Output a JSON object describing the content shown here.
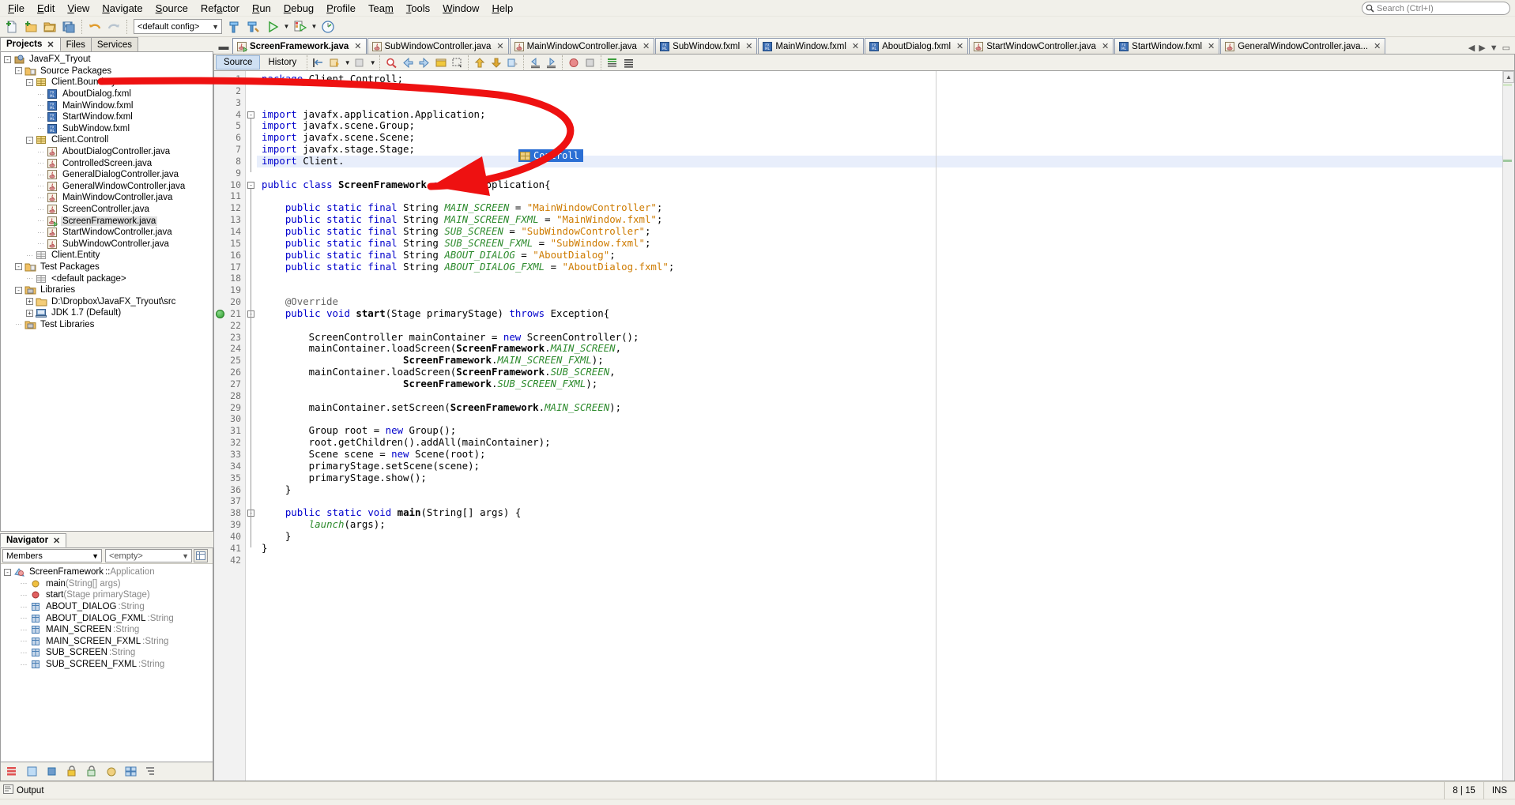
{
  "window": {
    "title": "NetBeans IDE"
  },
  "menubar": {
    "items": [
      {
        "label": "File",
        "mnemonic": "F"
      },
      {
        "label": "Edit",
        "mnemonic": "E"
      },
      {
        "label": "View",
        "mnemonic": "V"
      },
      {
        "label": "Navigate",
        "mnemonic": "N"
      },
      {
        "label": "Source",
        "mnemonic": "S"
      },
      {
        "label": "Refactor",
        "mnemonic": "a"
      },
      {
        "label": "Run",
        "mnemonic": "R"
      },
      {
        "label": "Debug",
        "mnemonic": "D"
      },
      {
        "label": "Profile",
        "mnemonic": "P"
      },
      {
        "label": "Team",
        "mnemonic": "m"
      },
      {
        "label": "Tools",
        "mnemonic": "T"
      },
      {
        "label": "Window",
        "mnemonic": "W"
      },
      {
        "label": "Help",
        "mnemonic": "H"
      }
    ],
    "search_placeholder": "Search (Ctrl+I)"
  },
  "toolbar": {
    "config_value": "<default config>",
    "buttons": [
      {
        "name": "new-file-button",
        "title": "New File"
      },
      {
        "name": "new-project-button",
        "title": "New Project"
      },
      {
        "name": "open-project-button",
        "title": "Open Project"
      },
      {
        "name": "save-all-button",
        "title": "Save All"
      },
      {
        "name": "undo-button",
        "title": "Undo"
      },
      {
        "name": "redo-button",
        "title": "Redo"
      },
      {
        "name": "build-project-button",
        "title": "Build Project"
      },
      {
        "name": "clean-build-button",
        "title": "Clean and Build Project"
      },
      {
        "name": "run-project-button",
        "title": "Run Project"
      },
      {
        "name": "debug-project-button",
        "title": "Debug Project"
      },
      {
        "name": "profile-project-button",
        "title": "Profile Project"
      }
    ]
  },
  "left_panel": {
    "tabs": [
      {
        "label": "Projects",
        "active": true,
        "closable": true
      },
      {
        "label": "Files",
        "active": false,
        "closable": false
      },
      {
        "label": "Services",
        "active": false,
        "closable": false
      }
    ],
    "tree": [
      {
        "label": "JavaFX_Tryout",
        "indent": 0,
        "icon": "project-icon",
        "expander": "-"
      },
      {
        "label": "Source Packages",
        "indent": 1,
        "icon": "source-packages-icon",
        "expander": "-"
      },
      {
        "label": "Client.Boundary",
        "indent": 2,
        "icon": "package-icon",
        "expander": "-"
      },
      {
        "label": "AboutDialog.fxml",
        "indent": 3,
        "icon": "fxml-icon",
        "expander": ""
      },
      {
        "label": "MainWindow.fxml",
        "indent": 3,
        "icon": "fxml-icon",
        "expander": ""
      },
      {
        "label": "StartWindow.fxml",
        "indent": 3,
        "icon": "fxml-icon",
        "expander": ""
      },
      {
        "label": "SubWindow.fxml",
        "indent": 3,
        "icon": "fxml-icon",
        "expander": ""
      },
      {
        "label": "Client.Controll",
        "indent": 2,
        "icon": "package-icon",
        "expander": "-"
      },
      {
        "label": "AboutDialogController.java",
        "indent": 3,
        "icon": "java-icon",
        "expander": ""
      },
      {
        "label": "ControlledScreen.java",
        "indent": 3,
        "icon": "java-icon",
        "expander": ""
      },
      {
        "label": "GeneralDialogController.java",
        "indent": 3,
        "icon": "java-icon",
        "expander": ""
      },
      {
        "label": "GeneralWindowController.java",
        "indent": 3,
        "icon": "java-icon",
        "expander": ""
      },
      {
        "label": "MainWindowController.java",
        "indent": 3,
        "icon": "java-icon",
        "expander": ""
      },
      {
        "label": "ScreenController.java",
        "indent": 3,
        "icon": "java-icon",
        "expander": ""
      },
      {
        "label": "ScreenFramework.java",
        "indent": 3,
        "icon": "java-main-icon",
        "expander": "",
        "selected": true
      },
      {
        "label": "StartWindowController.java",
        "indent": 3,
        "icon": "java-icon",
        "expander": ""
      },
      {
        "label": "SubWindowController.java",
        "indent": 3,
        "icon": "java-icon",
        "expander": ""
      },
      {
        "label": "Client.Entity",
        "indent": 2,
        "icon": "package-empty-icon",
        "expander": ""
      },
      {
        "label": "Test Packages",
        "indent": 1,
        "icon": "test-packages-icon",
        "expander": "-"
      },
      {
        "label": "<default package>",
        "indent": 2,
        "icon": "package-empty-icon",
        "expander": ""
      },
      {
        "label": "Libraries",
        "indent": 1,
        "icon": "libraries-icon",
        "expander": "-"
      },
      {
        "label": "D:\\Dropbox\\JavaFX_Tryout\\src",
        "indent": 2,
        "icon": "folder-icon",
        "expander": "+"
      },
      {
        "label": "JDK 1.7 (Default)",
        "indent": 2,
        "icon": "jdk-icon",
        "expander": "+"
      },
      {
        "label": "Test Libraries",
        "indent": 1,
        "icon": "libraries-icon",
        "expander": ""
      }
    ]
  },
  "navigator": {
    "tab_label": "Navigator",
    "filter_value": "Members",
    "scope_value": "<empty>",
    "root": {
      "label": "ScreenFramework",
      "type": "Application",
      "separator": "::"
    },
    "members": [
      {
        "label": "main(String[] args)",
        "icon": "method-static-icon",
        "type": ""
      },
      {
        "label": "start(Stage primaryStage)",
        "icon": "method-icon",
        "type": ""
      },
      {
        "label": "ABOUT_DIALOG",
        "icon": "field-icon",
        "type": "String",
        "separator": ":"
      },
      {
        "label": "ABOUT_DIALOG_FXML",
        "icon": "field-icon",
        "type": "String",
        "separator": ":"
      },
      {
        "label": "MAIN_SCREEN",
        "icon": "field-icon",
        "type": "String",
        "separator": ":"
      },
      {
        "label": "MAIN_SCREEN_FXML",
        "icon": "field-icon",
        "type": "String",
        "separator": ":"
      },
      {
        "label": "SUB_SCREEN",
        "icon": "field-icon",
        "type": "String",
        "separator": ":"
      },
      {
        "label": "SUB_SCREEN_FXML",
        "icon": "field-icon",
        "type": "String",
        "separator": ":"
      }
    ],
    "bottom_buttons": [
      {
        "name": "sort-alphabetical-button"
      },
      {
        "name": "show-inherited-button"
      },
      {
        "name": "show-fields-button"
      },
      {
        "name": "show-private-button"
      },
      {
        "name": "show-static-button"
      },
      {
        "name": "show-non-public-button"
      },
      {
        "name": "filters-button"
      },
      {
        "name": "expand-all-button"
      }
    ]
  },
  "editor": {
    "tabs": [
      {
        "label": "ScreenFramework.java",
        "icon": "java-main-icon",
        "active": true
      },
      {
        "label": "SubWindowController.java",
        "icon": "java-icon",
        "active": false
      },
      {
        "label": "MainWindowController.java",
        "icon": "java-icon",
        "active": false
      },
      {
        "label": "SubWindow.fxml",
        "icon": "fxml-icon",
        "active": false
      },
      {
        "label": "MainWindow.fxml",
        "icon": "fxml-icon",
        "active": false
      },
      {
        "label": "AboutDialog.fxml",
        "icon": "fxml-icon",
        "active": false
      },
      {
        "label": "StartWindowController.java",
        "icon": "java-icon",
        "active": false
      },
      {
        "label": "StartWindow.fxml",
        "icon": "fxml-icon",
        "active": false
      },
      {
        "label": "GeneralWindowController.java...",
        "icon": "java-icon",
        "active": false
      }
    ],
    "view_buttons": [
      {
        "label": "Source",
        "active": true
      },
      {
        "label": "History",
        "active": false
      }
    ],
    "autocomplete": {
      "visible": true,
      "item": "Controll",
      "icon": "package-icon"
    },
    "code_lines": [
      {
        "n": 1,
        "text": "package Client.Controll;",
        "tokens": [
          [
            "kw",
            "package"
          ],
          [
            "plain",
            " Client.Controll;"
          ]
        ],
        "indent": 0
      },
      {
        "n": 2,
        "text": "",
        "tokens": [],
        "indent": 0
      },
      {
        "n": 3,
        "text": "",
        "tokens": [],
        "indent": 0
      },
      {
        "n": 4,
        "text": "import javafx.application.Application;",
        "tokens": [
          [
            "kw",
            "import"
          ],
          [
            "plain",
            " javafx.application.Application;"
          ]
        ],
        "fold": "-"
      },
      {
        "n": 5,
        "text": "import javafx.scene.Group;",
        "tokens": [
          [
            "kw",
            "import"
          ],
          [
            "plain",
            " javafx.scene.Group;"
          ]
        ]
      },
      {
        "n": 6,
        "text": "import javafx.scene.Scene;",
        "tokens": [
          [
            "kw",
            "import"
          ],
          [
            "plain",
            " javafx.scene.Scene;"
          ]
        ]
      },
      {
        "n": 7,
        "text": "import javafx.stage.Stage;",
        "tokens": [
          [
            "kw",
            "import"
          ],
          [
            "plain",
            " javafx.stage.Stage;"
          ]
        ]
      },
      {
        "n": 8,
        "text": "import Client.",
        "tokens": [
          [
            "kw",
            "import"
          ],
          [
            "plain",
            " Client."
          ]
        ],
        "highlight": true
      },
      {
        "n": 9,
        "text": "",
        "tokens": []
      },
      {
        "n": 10,
        "text": "public class ScreenFramework extends Application{",
        "tokens": [
          [
            "kw",
            "public "
          ],
          [
            "kw",
            "class "
          ],
          [
            "bold",
            "ScreenFramework "
          ],
          [
            "kw",
            "extends "
          ],
          [
            "plain",
            "Application{"
          ]
        ]
      },
      {
        "n": 11,
        "text": "",
        "tokens": []
      },
      {
        "n": 12,
        "text": "    public static final String MAIN_SCREEN = \"MainWindowController\";"
      },
      {
        "n": 13,
        "text": "    public static final String MAIN_SCREEN_FXML = \"MainWindow.fxml\";"
      },
      {
        "n": 14,
        "text": "    public static final String SUB_SCREEN = \"SubWindowController\";"
      },
      {
        "n": 15,
        "text": "    public static final String SUB_SCREEN_FXML = \"SubWindow.fxml\";"
      },
      {
        "n": 16,
        "text": "    public static final String ABOUT_DIALOG = \"AboutDialog\";"
      },
      {
        "n": 17,
        "text": "    public static final String ABOUT_DIALOG_FXML = \"AboutDialog.fxml\";"
      },
      {
        "n": 18,
        "text": ""
      },
      {
        "n": 19,
        "text": ""
      },
      {
        "n": 20,
        "text": "    @Override"
      },
      {
        "n": 21,
        "text": "    public void start(Stage primaryStage) throws Exception{"
      },
      {
        "n": 22,
        "text": ""
      },
      {
        "n": 23,
        "text": "        ScreenController mainContainer = new ScreenController();"
      },
      {
        "n": 24,
        "text": "        mainContainer.loadScreen(ScreenFramework.MAIN_SCREEN,"
      },
      {
        "n": 25,
        "text": "                        ScreenFramework.MAIN_SCREEN_FXML);"
      },
      {
        "n": 26,
        "text": "        mainContainer.loadScreen(ScreenFramework.SUB_SCREEN,"
      },
      {
        "n": 27,
        "text": "                        ScreenFramework.SUB_SCREEN_FXML);"
      },
      {
        "n": 28,
        "text": ""
      },
      {
        "n": 29,
        "text": "        mainContainer.setScreen(ScreenFramework.MAIN_SCREEN);"
      },
      {
        "n": 30,
        "text": ""
      },
      {
        "n": 31,
        "text": "        Group root = new Group();"
      },
      {
        "n": 32,
        "text": "        root.getChildren().addAll(mainContainer);"
      },
      {
        "n": 33,
        "text": "        Scene scene = new Scene(root);"
      },
      {
        "n": 34,
        "text": "        primaryStage.setScene(scene);"
      },
      {
        "n": 35,
        "text": "        primaryStage.show();"
      },
      {
        "n": 36,
        "text": "    }"
      },
      {
        "n": 37,
        "text": ""
      },
      {
        "n": 38,
        "text": "    public static void main(String[] args) {"
      },
      {
        "n": 39,
        "text": "        launch(args);"
      },
      {
        "n": 40,
        "text": "    }"
      },
      {
        "n": 41,
        "text": "}"
      },
      {
        "n": 42,
        "text": ""
      }
    ]
  },
  "statusbar": {
    "output_label": "Output",
    "cursor_position": "8 | 15",
    "insert_mode": "INS"
  },
  "colors": {
    "keyword": "#0000cc",
    "string": "#ce7b00",
    "constant": "#2e8b2e",
    "annotation": "#646464",
    "selection": "#2b6fd4",
    "line_highlight": "#e8eefb",
    "annotation_arrow": "#ee1111"
  }
}
